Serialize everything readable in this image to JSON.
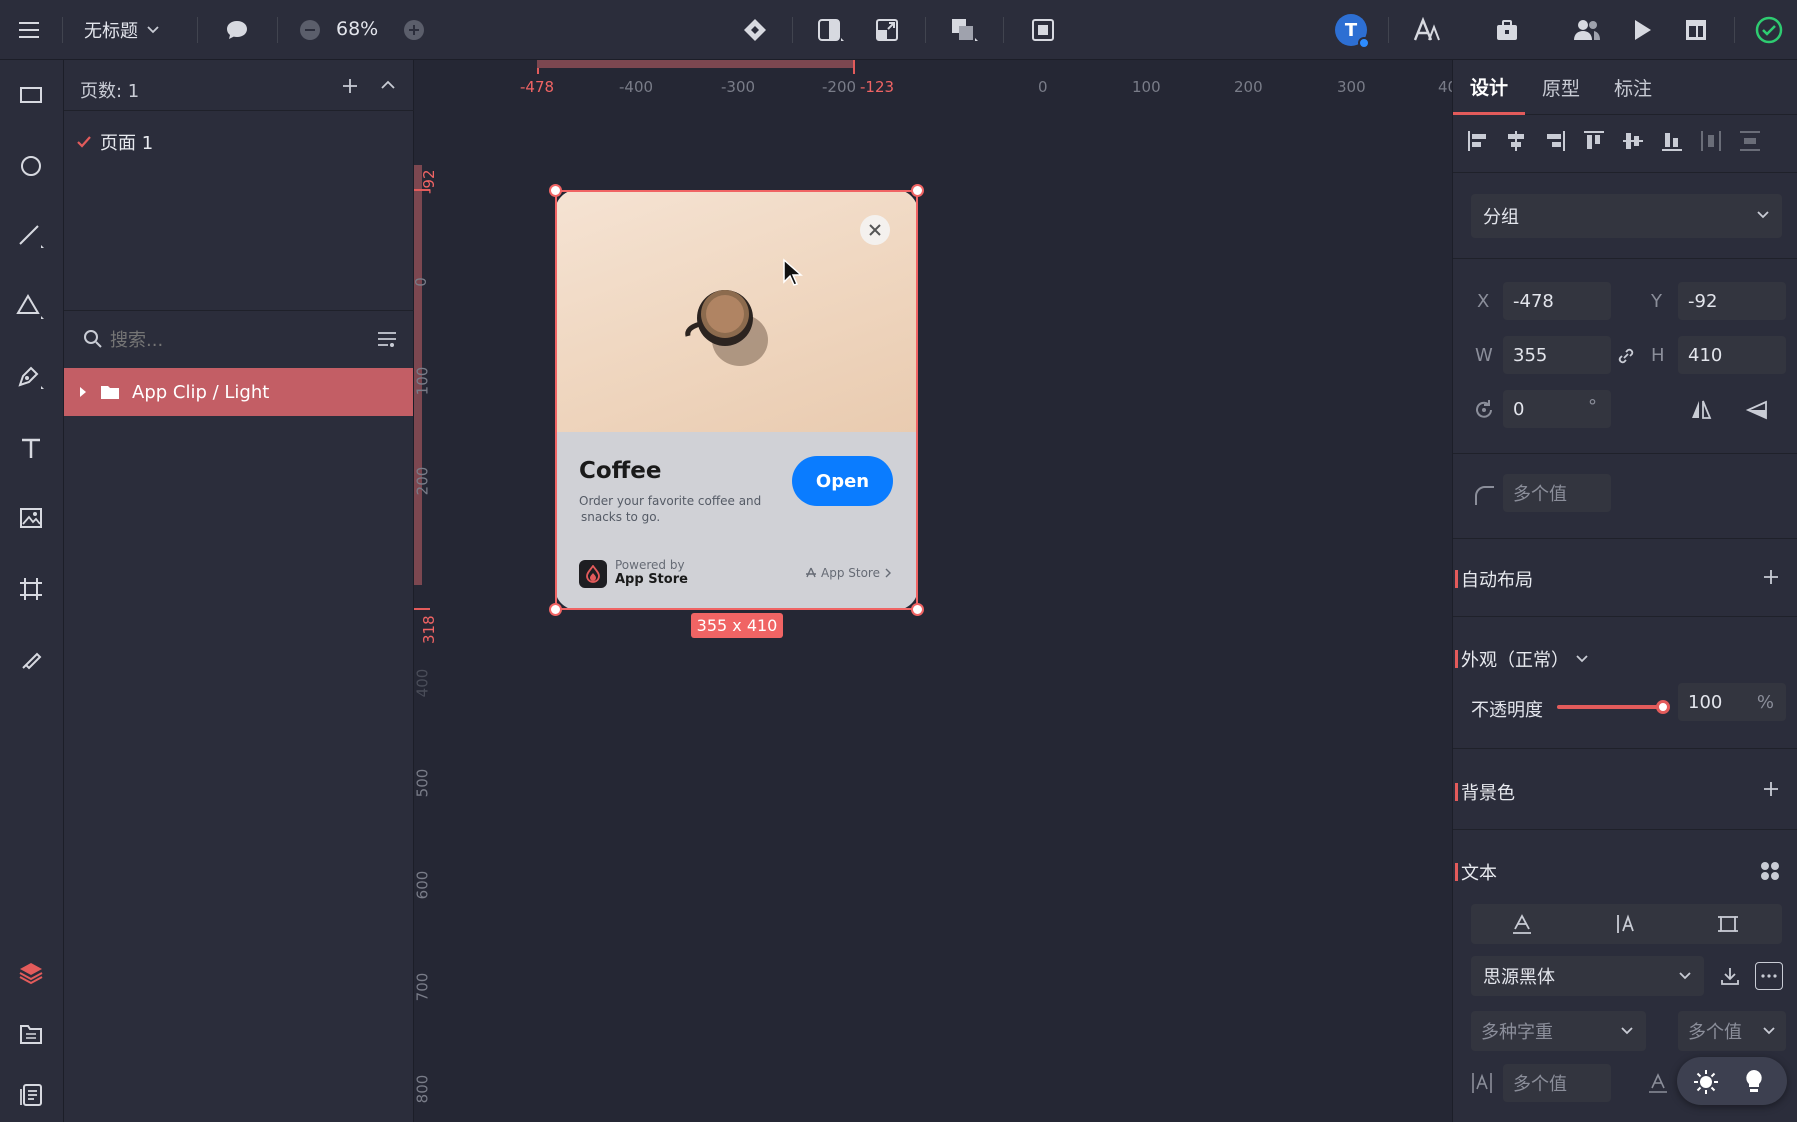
{
  "topbar": {
    "file_title": "无标题",
    "zoom": "68%",
    "avatar_letter": "T"
  },
  "layers": {
    "page_count_label": "页数: 1",
    "pages": [
      {
        "label": "页面 1",
        "selected": true
      }
    ],
    "search_placeholder": "搜索...",
    "items": [
      {
        "label": "App Clip / Light",
        "selected": true
      }
    ]
  },
  "canvas": {
    "ruler_h": {
      "sel_start": "-478",
      "sel_end": "-123",
      "ticks": [
        "-400",
        "-300",
        "-200",
        "0",
        "100",
        "200",
        "300",
        "40"
      ]
    },
    "ruler_v": {
      "sel_start": "-92",
      "sel_end": "318",
      "ticks": [
        "0",
        "100",
        "200",
        "400",
        "500",
        "600",
        "700",
        "800"
      ]
    },
    "size_badge": "355 x 410",
    "card": {
      "title": "Coffee",
      "description_line1": "Order your favorite coffee and",
      "description_line2": "snacks to go.",
      "open_label": "Open",
      "powered_by": "Powered by",
      "store_name": "App Store",
      "store_link": "App Store"
    }
  },
  "design_panel": {
    "tabs": [
      {
        "label": "设计",
        "active": true
      },
      {
        "label": "原型",
        "active": false
      },
      {
        "label": "标注",
        "active": false
      }
    ],
    "type_select": "分组",
    "x_label": "X",
    "x_value": "-478",
    "y_label": "Y",
    "y_value": "-92",
    "w_label": "W",
    "w_value": "355",
    "h_label": "H",
    "h_value": "410",
    "rotation_value": "0",
    "rotation_unit": "°",
    "radius_value": "多个值",
    "auto_layout_title": "自动布局",
    "appearance_title": "外观（正常）",
    "opacity_label": "不透明度",
    "opacity_value": "100",
    "opacity_unit": "%",
    "opacity_level": 1.0,
    "background_title": "背景色",
    "text_title": "文本",
    "font_family": "思源黑体",
    "font_weight": "多种字重",
    "font_size": "多个值",
    "line_height": "多个值"
  },
  "colors": {
    "accent": "#e35b5b",
    "selection": "#f06464",
    "open_button": "#0a7cff",
    "success": "#2ecc71",
    "avatar": "#2d6fd3"
  }
}
